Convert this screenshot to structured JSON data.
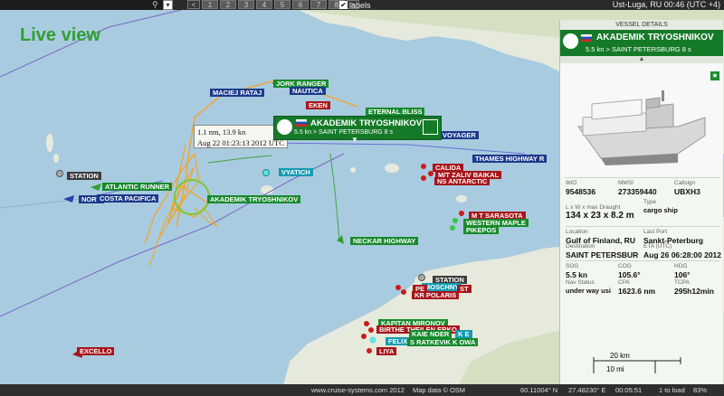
{
  "topbar": {
    "search_dropdown": "▾",
    "pages": [
      "1",
      "2",
      "3",
      "4",
      "5",
      "6",
      "7",
      "8"
    ],
    "next": ">",
    "prev": "<",
    "labels_toggle": "labels",
    "labels_checked": "✔",
    "clock": "Ust-Luga, RU   00:46 (UTC +4)"
  },
  "map": {
    "title": "Live view",
    "tooltip": {
      "line1": "1.1 nm, 13.9 kn",
      "line2": "Aug 22 01:23:13 2012 UTC"
    },
    "popup": {
      "name": "AKADEMIK TRYOSHNIKOV",
      "sub": "5.5 kn > SAINT PETERSBURG    8 s"
    },
    "labels": [
      {
        "text": "JORK RANGER",
        "cls": "green"
      },
      {
        "text": "MACIEJ RATAJ",
        "cls": "blue"
      },
      {
        "text": "NAUTICA",
        "cls": "blue"
      },
      {
        "text": "EKEN",
        "cls": "red"
      },
      {
        "text": "ETERNAL BLISS",
        "cls": "green"
      },
      {
        "text": "VOYAGER",
        "cls": "blue"
      },
      {
        "text": "STATION",
        "cls": "gray"
      },
      {
        "text": "ATLANTIC RUNNER",
        "cls": "green"
      },
      {
        "text": "NORV",
        "cls": "blue"
      },
      {
        "text": "COSTA PACIFICA",
        "cls": "blue"
      },
      {
        "text": "AKADEMIK TRYOSHNIKOV",
        "cls": "green"
      },
      {
        "text": "VYATICH",
        "cls": "teal"
      },
      {
        "text": "CALIDA",
        "cls": "red"
      },
      {
        "text": "M/T ZALIV BAIKAL",
        "cls": "red"
      },
      {
        "text": "NS ANTARCTIC",
        "cls": "red"
      },
      {
        "text": "THAMES HIGHWAY R",
        "cls": "blue"
      },
      {
        "text": "M T SARASOTA",
        "cls": "red"
      },
      {
        "text": "WESTERN MAPLE",
        "cls": "green"
      },
      {
        "text": "PIKEPOS",
        "cls": "green"
      },
      {
        "text": "NECKAR HIGHWAY",
        "cls": "green"
      },
      {
        "text": "STATION",
        "cls": "gray"
      },
      {
        "text": "MOSCHNY",
        "cls": "teal"
      },
      {
        "text": "PE",
        "cls": "red"
      },
      {
        "text": "ST",
        "cls": "red"
      },
      {
        "text": "KR POLARIS",
        "cls": "red"
      },
      {
        "text": "KAPITAN MIRONOV",
        "cls": "green"
      },
      {
        "text": "BIRTHE THEILEN ERKO",
        "cls": "red"
      },
      {
        "text": "KAIE NDER",
        "cls": "green"
      },
      {
        "text": "FELIX",
        "cls": "teal"
      },
      {
        "text": "S RATKEVIK K OWA",
        "cls": "green"
      },
      {
        "text": "K E",
        "cls": "teal"
      },
      {
        "text": "LIYA",
        "cls": "red"
      },
      {
        "text": "EXCELLO",
        "cls": "red"
      }
    ],
    "scale_km": "20 km",
    "scale_mi": "10 mi"
  },
  "panel": {
    "header": "VESSEL DETAILS",
    "name": "AKADEMIK TRYOSHNIKOV",
    "sub": "5.5 kn > SAINT PETERSBURG     8 s",
    "collapse": "▲",
    "star": "★",
    "fields": {
      "imo_k": "IMO",
      "imo_v": "9548536",
      "mmsi_k": "MMSI",
      "mmsi_v": "273359440",
      "callsign_k": "Callsign",
      "callsign_v": "UBXH3",
      "dims_k": "L x W x max Draught",
      "dims_v": "134 x 23 x 8.2 m",
      "type_k": "Type",
      "type_v": "cargo ship",
      "location_k": "Location",
      "location_v": "Gulf of Finland, RU",
      "lastport_k": "Last Port",
      "lastport_v": "Sankt-Peterburg",
      "dest_k": "Destination",
      "dest_v": "SAINT PETERSBUR",
      "eta_k": "ETA (UTC)",
      "eta_v": "Aug 26 06:28:00 2012",
      "sog_k": "SOG",
      "sog_v": "5.5 kn",
      "cog_k": "COG",
      "cog_v": "105.6°",
      "hdg_k": "HDG",
      "hdg_v": "106°",
      "nav_k": "Nav Status",
      "nav_v": "under way usi",
      "cpa_k": "CPA",
      "cpa_v": "1623.6 nm",
      "tcpa_k": "TCPA",
      "tcpa_v": "295h12min"
    }
  },
  "status": {
    "site": "www.cruise-systems.com 2012",
    "mapdata": "Map data © OSM",
    "lat": "60.11004° N",
    "lon": "27.48230° E",
    "time": "00:05:51",
    "load": "1 to load",
    "zoom": "83%"
  },
  "colors": {
    "sea": "#a9cbe0",
    "land": "#e6eadc",
    "track": "#f7a21e",
    "panel_green": "#157a28"
  }
}
